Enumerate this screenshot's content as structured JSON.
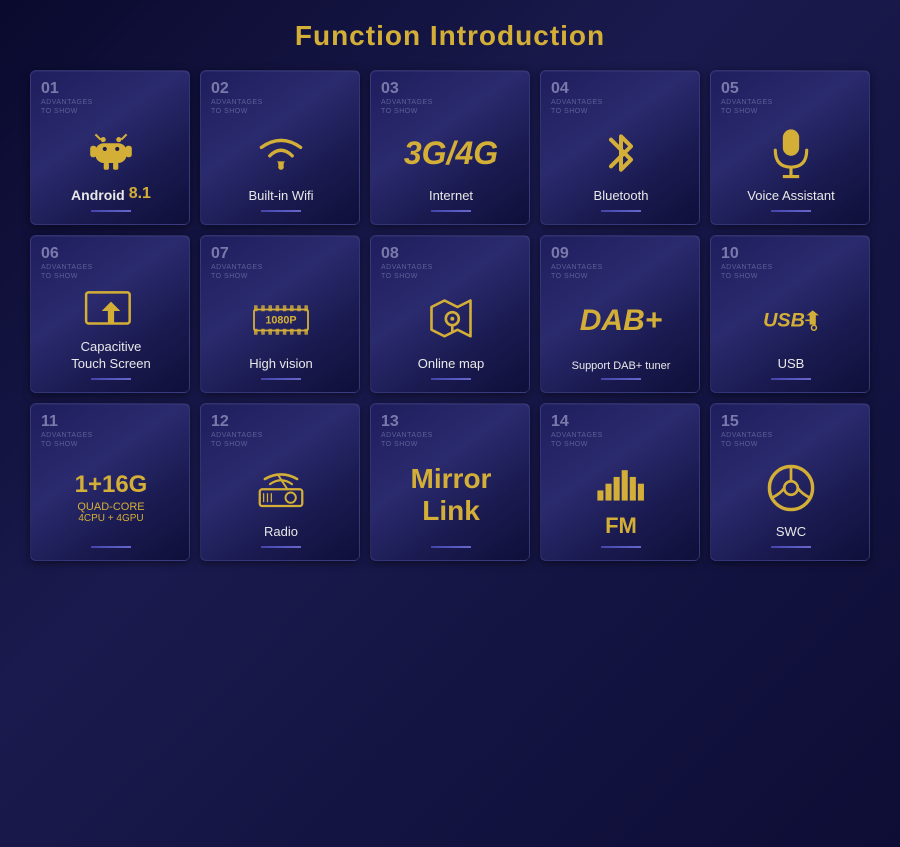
{
  "title": "Function Introduction",
  "cards": [
    {
      "id": "01",
      "subtitle": "ADVANTAGES\nTO SHOW",
      "label": "Android 8.1",
      "type": "android"
    },
    {
      "id": "02",
      "subtitle": "ADVANTAGES\nTO SHOW",
      "label": "Built-in Wifi",
      "type": "wifi"
    },
    {
      "id": "03",
      "subtitle": "ADVANTAGES\nTO SHOW",
      "label": "Internet",
      "type": "3g4g"
    },
    {
      "id": "04",
      "subtitle": "ADVANTAGES\nTO SHOW",
      "label": "Bluetooth",
      "type": "bluetooth"
    },
    {
      "id": "05",
      "subtitle": "ADVANTAGES\nTO SHOW",
      "label": "Voice Assistant",
      "type": "voice"
    },
    {
      "id": "06",
      "subtitle": "ADVANTAGES\nTO SHOW",
      "label": "Capacitive\nTouch Screen",
      "type": "touch"
    },
    {
      "id": "07",
      "subtitle": "ADVANTAGES\nTO SHOW",
      "label": "High vision",
      "type": "1080p"
    },
    {
      "id": "08",
      "subtitle": "ADVANTAGES\nTO SHOW",
      "label": "Online map",
      "type": "map"
    },
    {
      "id": "09",
      "subtitle": "ADVANTAGES\nTO SHOW",
      "label": "Support DAB+ tuner",
      "type": "dab"
    },
    {
      "id": "10",
      "subtitle": "ADVANTAGES\nTO SHOW",
      "label": "USB",
      "type": "usb"
    },
    {
      "id": "11",
      "subtitle": "ADVANTAGES\nTO SHOW",
      "label": "1+16G QUAD-CORE 4CPU + 4GPU",
      "type": "cpu"
    },
    {
      "id": "12",
      "subtitle": "ADVANTAGES\nTO SHOW",
      "label": "Radio",
      "type": "radio"
    },
    {
      "id": "13",
      "subtitle": "ADVANTAGES\nTO SHOW",
      "label": "Mirror Link",
      "type": "mirror"
    },
    {
      "id": "14",
      "subtitle": "ADVANTAGES\nTO SHOW",
      "label": "FM",
      "type": "fm"
    },
    {
      "id": "15",
      "subtitle": "ADVANTAGES\nTO SHOW",
      "label": "SWC",
      "type": "swc"
    }
  ]
}
